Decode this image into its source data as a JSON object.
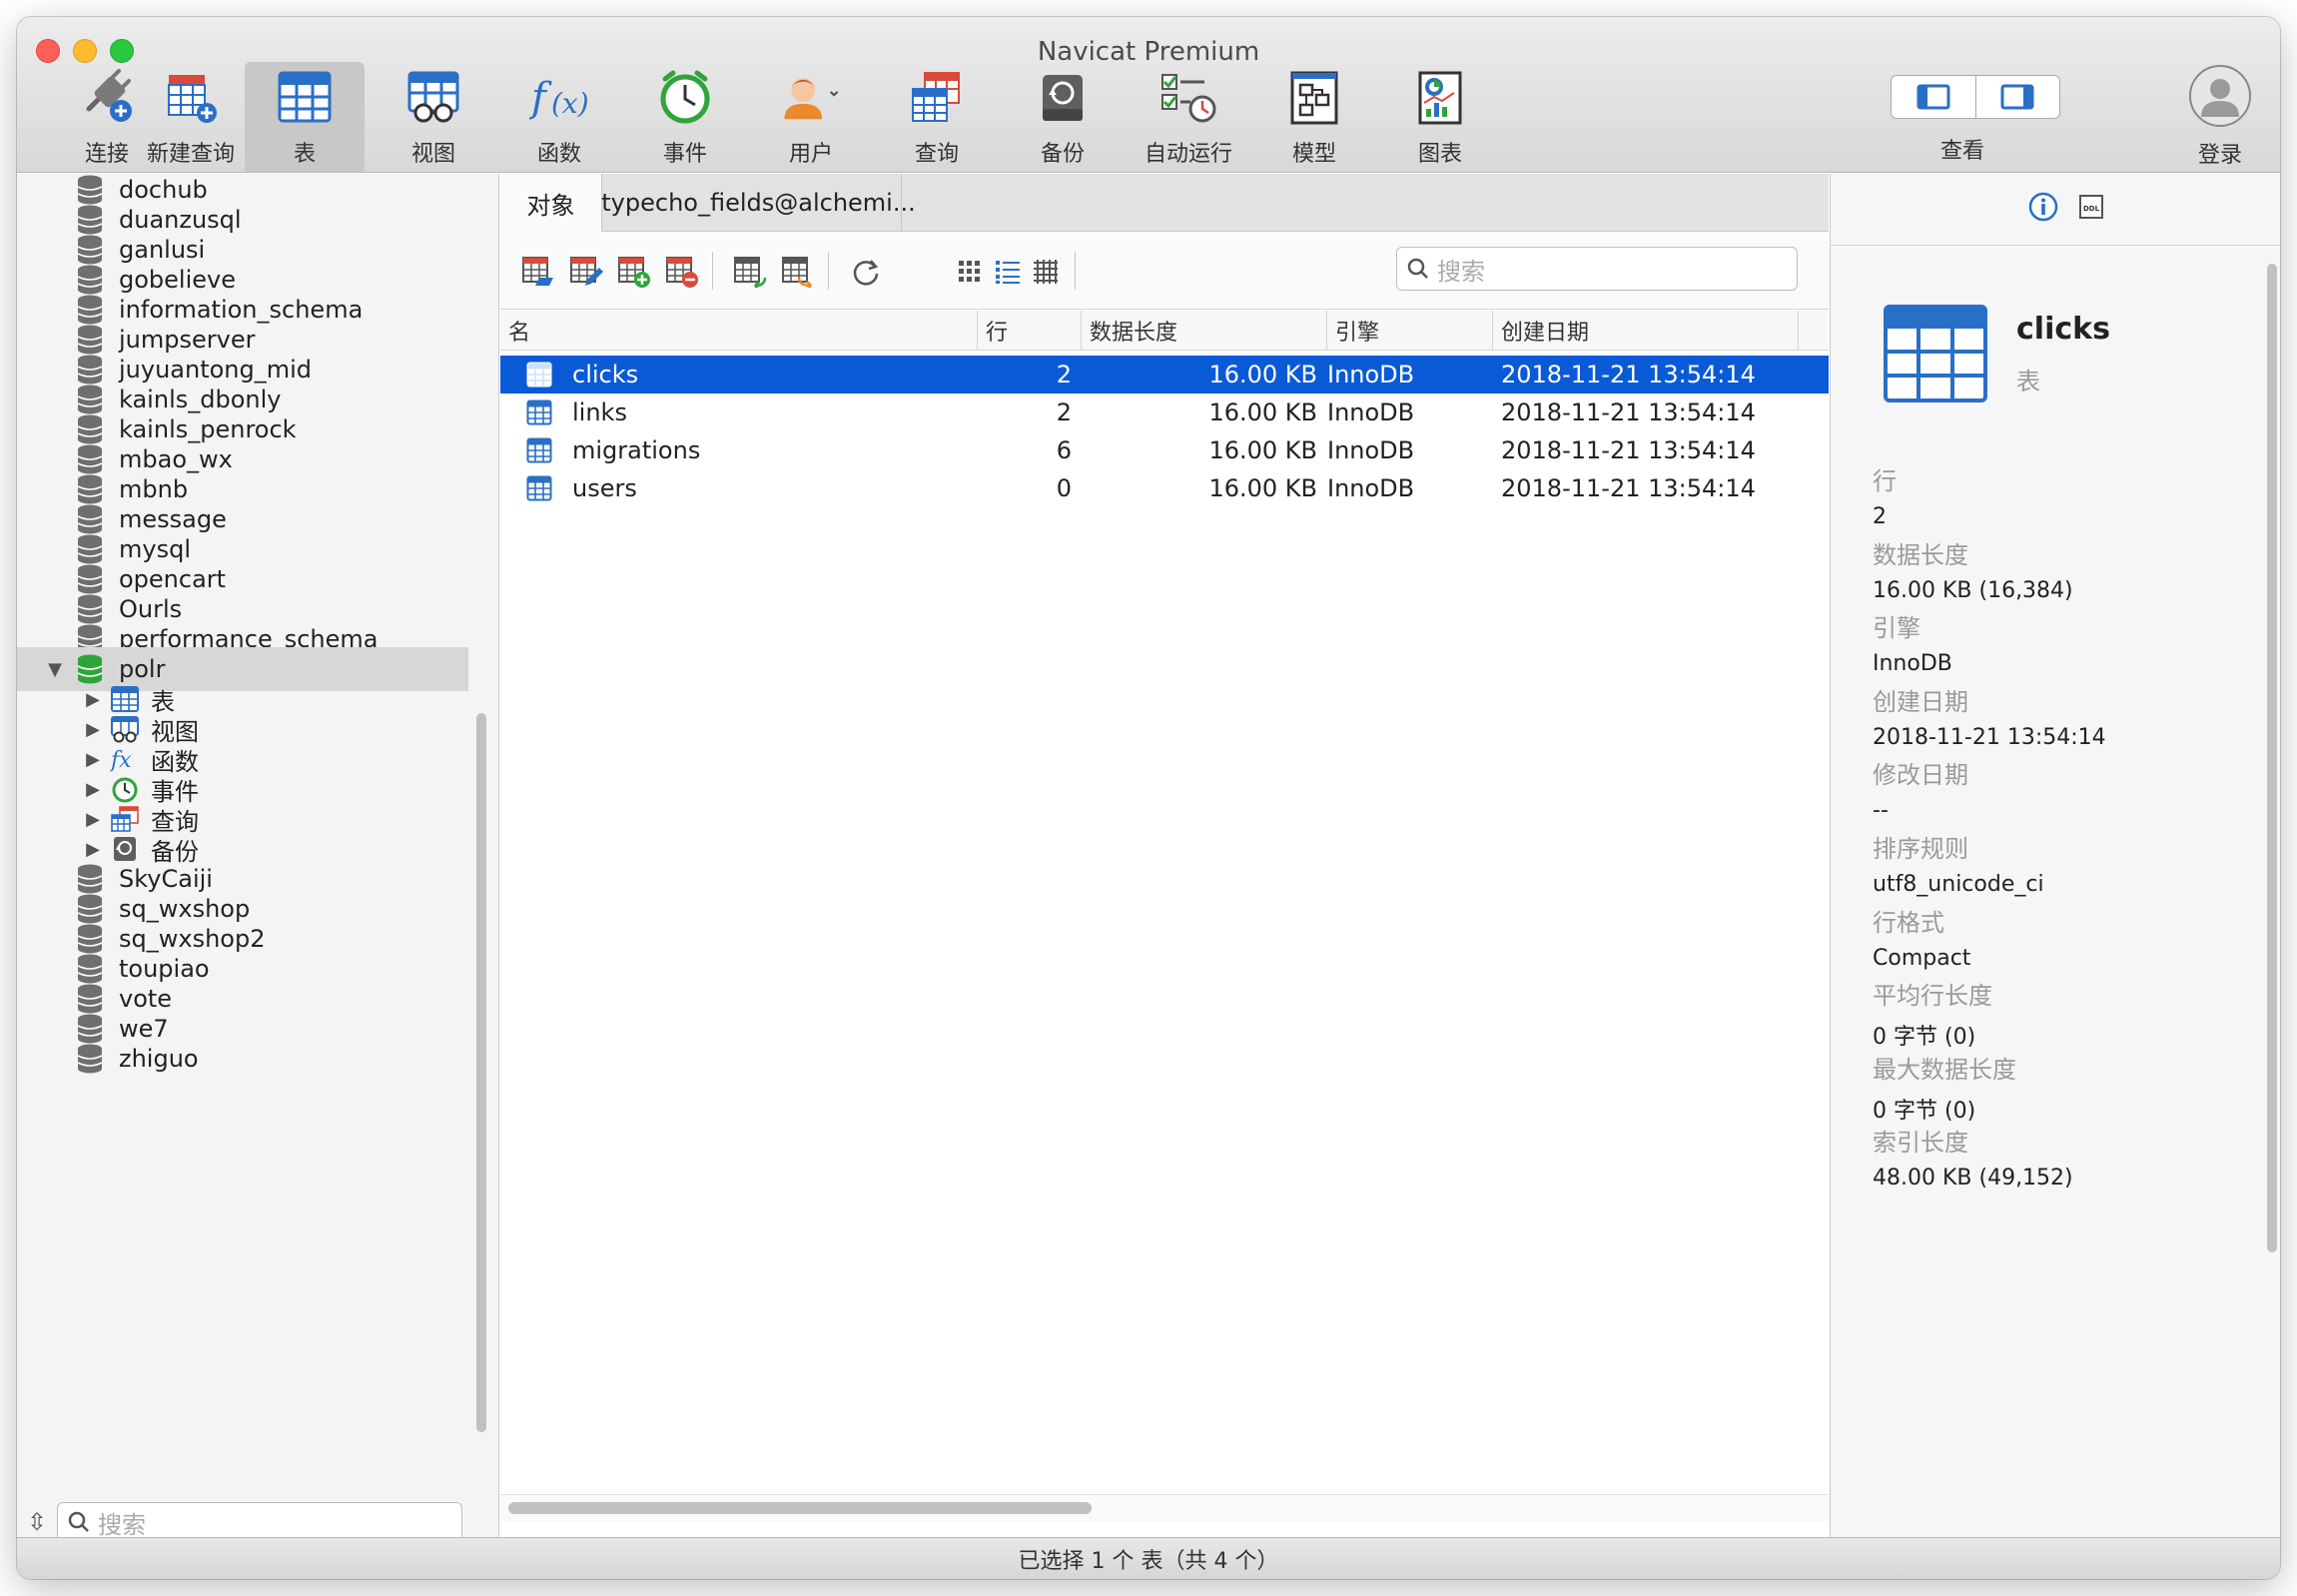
{
  "window": {
    "title": "Navicat Premium"
  },
  "toolbar": {
    "items": [
      {
        "label": "连接",
        "icon": "plug-add-icon"
      },
      {
        "label": "新建查询",
        "icon": "new-query-icon"
      },
      {
        "label": "表",
        "icon": "table-icon"
      },
      {
        "label": "视图",
        "icon": "view-icon"
      },
      {
        "label": "函数",
        "icon": "function-icon"
      },
      {
        "label": "事件",
        "icon": "clock-icon"
      },
      {
        "label": "用户",
        "icon": "user-icon"
      },
      {
        "label": "查询",
        "icon": "query-icon"
      },
      {
        "label": "备份",
        "icon": "backup-icon"
      },
      {
        "label": "自动运行",
        "icon": "automation-icon"
      },
      {
        "label": "模型",
        "icon": "model-icon"
      },
      {
        "label": "图表",
        "icon": "chart-icon"
      }
    ],
    "view_label": "查看",
    "login_label": "登录"
  },
  "sidebar": {
    "databases_above": [
      "dochub",
      "duanzusql",
      "ganlusi",
      "gobelieve",
      "information_schema",
      "jumpserver",
      "juyuantong_mid",
      "kainls_dbonly",
      "kainls_penrock",
      "mbao_wx",
      "mbnb",
      "message",
      "mysql",
      "opencart",
      "Ourls",
      "performance_schema"
    ],
    "expanded_db": "polr",
    "children": [
      {
        "label": "表",
        "icon": "table-icon"
      },
      {
        "label": "视图",
        "icon": "view-icon"
      },
      {
        "label": "函数",
        "icon": "function-icon"
      },
      {
        "label": "事件",
        "icon": "clock-icon"
      },
      {
        "label": "查询",
        "icon": "query-icon"
      },
      {
        "label": "备份",
        "icon": "backup-icon"
      }
    ],
    "databases_below": [
      "SkyCaiji",
      "sq_wxshop",
      "sq_wxshop2",
      "toupiao",
      "vote",
      "we7",
      "zhiguo"
    ],
    "search_placeholder": "搜索"
  },
  "main": {
    "tabs": [
      {
        "label": "对象"
      },
      {
        "label": "typecho_fields@alchemi..."
      }
    ],
    "search_placeholder": "搜索",
    "columns": [
      "名",
      "行",
      "数据长度",
      "引擎",
      "创建日期"
    ],
    "rows": [
      {
        "name": "clicks",
        "rows": "2",
        "data_length": "16.00 KB",
        "engine": "InnoDB",
        "created": "2018-11-21 13:54:14"
      },
      {
        "name": "links",
        "rows": "2",
        "data_length": "16.00 KB",
        "engine": "InnoDB",
        "created": "2018-11-21 13:54:14"
      },
      {
        "name": "migrations",
        "rows": "6",
        "data_length": "16.00 KB",
        "engine": "InnoDB",
        "created": "2018-11-21 13:54:14"
      },
      {
        "name": "users",
        "rows": "0",
        "data_length": "16.00 KB",
        "engine": "InnoDB",
        "created": "2018-11-21 13:54:14"
      }
    ],
    "selected_row": 0
  },
  "info": {
    "name": "clicks",
    "kind": "表",
    "properties": [
      {
        "key": "行",
        "value": "2"
      },
      {
        "key": "数据长度",
        "value": "16.00 KB (16,384)"
      },
      {
        "key": "引擎",
        "value": "InnoDB"
      },
      {
        "key": "创建日期",
        "value": "2018-11-21 13:54:14"
      },
      {
        "key": "修改日期",
        "value": "--"
      },
      {
        "key": "排序规则",
        "value": "utf8_unicode_ci"
      },
      {
        "key": "行格式",
        "value": "Compact"
      },
      {
        "key": "平均行长度",
        "value": "0 字节 (0)"
      },
      {
        "key": "最大数据长度",
        "value": "0 字节 (0)"
      },
      {
        "key": "索引长度",
        "value": "48.00 KB (49,152)"
      }
    ]
  },
  "status": {
    "text": "已选择 1 个 表（共 4 个）"
  },
  "colors": {
    "selection": "#0a5ad7",
    "db_green": "#2fa43a",
    "table_blue": "#2a6fc6"
  }
}
